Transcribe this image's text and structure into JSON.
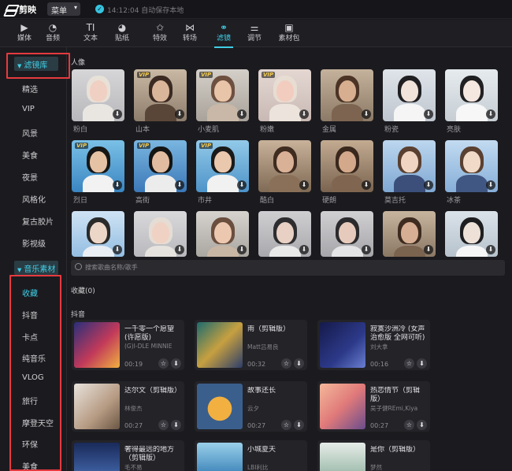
{
  "titlebar": {
    "app_name": "剪映",
    "menu_label": "菜单",
    "save_status": "14:12:04 自动保存本地"
  },
  "toolbar": [
    {
      "icon": "media-icon",
      "glyph": "▶",
      "label": "媒体"
    },
    {
      "icon": "audio-icon",
      "glyph": "◔",
      "label": "音频"
    },
    {
      "icon": "text-icon",
      "glyph": "TI",
      "label": "文本"
    },
    {
      "icon": "sticker-icon",
      "glyph": "◕",
      "label": "贴纸"
    },
    {
      "icon": "effects-icon",
      "glyph": "✩",
      "label": "特效"
    },
    {
      "icon": "transition-icon",
      "glyph": "⋈",
      "label": "转场"
    },
    {
      "icon": "filter-icon",
      "glyph": "⚭",
      "label": "滤镜",
      "active": true
    },
    {
      "icon": "adjust-icon",
      "glyph": "⚌",
      "label": "调节"
    },
    {
      "icon": "material-pack-icon",
      "glyph": "▣",
      "label": "素材包"
    }
  ],
  "sidebar": {
    "filter_header": "滤镜库",
    "filter_items": [
      "精选",
      "VIP",
      "风景",
      "美食",
      "夜景",
      "风格化",
      "复古胶片",
      "影视级"
    ],
    "music_header": "音乐素材",
    "music_items": [
      "收藏",
      "抖音",
      "卡点",
      "纯音乐",
      "VLOG",
      "旅行",
      "摩登天空",
      "环保",
      "美食"
    ],
    "active_music_item": "收藏"
  },
  "filters": {
    "section_title": "人像",
    "items": [
      {
        "label": "粉白",
        "vip": false
      },
      {
        "label": "山本",
        "vip": true
      },
      {
        "label": "小麦肌",
        "vip": true
      },
      {
        "label": "粉嫩",
        "vip": true
      },
      {
        "label": "金属",
        "vip": false
      },
      {
        "label": "粉瓷",
        "vip": false
      },
      {
        "label": "亮肤",
        "vip": false
      },
      {
        "label": "烈日",
        "vip": true
      },
      {
        "label": "高街",
        "vip": true
      },
      {
        "label": "市井",
        "vip": true
      },
      {
        "label": "酷白",
        "vip": false
      },
      {
        "label": "硬朗",
        "vip": false
      },
      {
        "label": "莫吉托",
        "vip": false
      },
      {
        "label": "冰茶",
        "vip": false
      },
      {
        "label": "",
        "vip": false
      },
      {
        "label": "",
        "vip": false
      },
      {
        "label": "",
        "vip": false
      },
      {
        "label": "",
        "vip": false
      },
      {
        "label": "",
        "vip": false
      },
      {
        "label": "",
        "vip": false
      },
      {
        "label": "",
        "vip": false
      }
    ],
    "download_icon": "download-icon",
    "vip_badge": "VIP"
  },
  "music": {
    "search_placeholder": "搜索歌曲名称/歌手",
    "favorites_title": "收藏(0)",
    "douyin_title": "抖音",
    "songs": [
      {
        "title": "一千零一个愿望 (许愿版)",
        "artist": "(G)I-DLE MINNIE",
        "duration": "00:19"
      },
      {
        "title": "雨（剪辑版）",
        "artist": "Matt吕易良",
        "duration": "00:32"
      },
      {
        "title": "寂寞沙洲冷 (女声治愈版 全网可听)",
        "artist": "刘大拿",
        "duration": "00:16"
      },
      {
        "title": "达尔文（剪辑版）",
        "artist": "林俊杰",
        "duration": "00:27"
      },
      {
        "title": "故事还长",
        "artist": "云夕",
        "duration": "00:27"
      },
      {
        "title": "热恋情节（剪辑版）",
        "artist": "吴子健REmi,Kiya",
        "duration": "00:27"
      },
      {
        "title": "奢得最远的地方（剪辑版）",
        "artist": "毛不易",
        "duration": ""
      },
      {
        "title": "小城夏天",
        "artist": "LBI利比",
        "duration": ""
      },
      {
        "title": "是你（剪辑版）",
        "artist": "梦然",
        "duration": ""
      }
    ]
  },
  "colors": {
    "accent": "#3fd0e6",
    "highlight_box": "#e53a3f",
    "vip": "#f2c84b"
  }
}
